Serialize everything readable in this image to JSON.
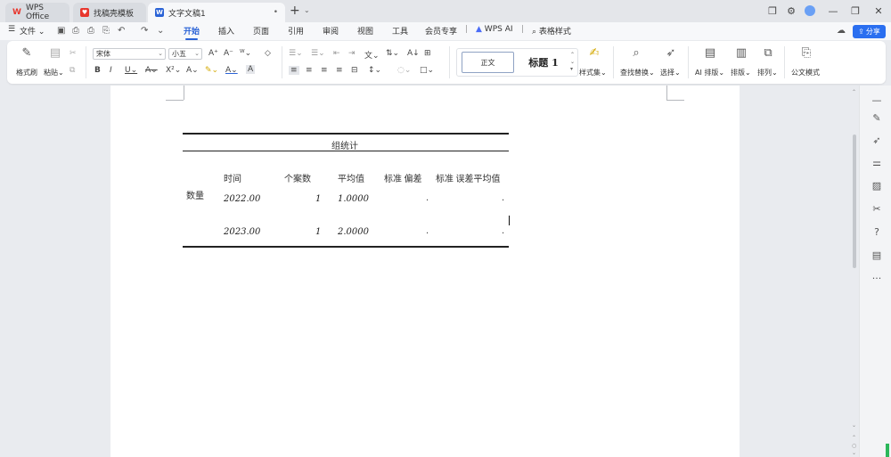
{
  "tabs": [
    {
      "label": "WPS Office",
      "icon": "W",
      "color": "#e8362d"
    },
    {
      "label": "找稿壳模板",
      "icon": "♥",
      "color": "#e8362d"
    },
    {
      "label": "文字文稿1",
      "icon": "W",
      "color": "#2b63d6"
    }
  ],
  "menu": {
    "file": "文件",
    "items": [
      "开始",
      "插入",
      "页面",
      "引用",
      "审阅",
      "视图",
      "工具",
      "会员专享"
    ],
    "wps_ai": "WPS AI",
    "table_style": "表格样式",
    "share": "分享"
  },
  "ribbon": {
    "format_painter": "格式刷",
    "paste": "粘贴",
    "font_name": "宋体",
    "font_size": "小五",
    "style_normal": "正文",
    "style_heading": "标题 1",
    "style_set": "样式集",
    "find_replace": "查找替换",
    "select": "选择",
    "ai_layout": "AI 排版",
    "typeset": "排版",
    "arrange": "排列",
    "official_mode": "公文模式"
  },
  "table": {
    "title": "组统计",
    "headers": [
      "时间",
      "个案数",
      "平均值",
      "标准 偏差",
      "标准 误差平均值"
    ],
    "row_label": "数量",
    "rows": [
      {
        "time": "2022.00",
        "n": "1",
        "mean": "1.0000",
        "sd": ".",
        "se": "."
      },
      {
        "time": "2023.00",
        "n": "1",
        "mean": "2.0000",
        "sd": ".",
        "se": "."
      }
    ]
  }
}
